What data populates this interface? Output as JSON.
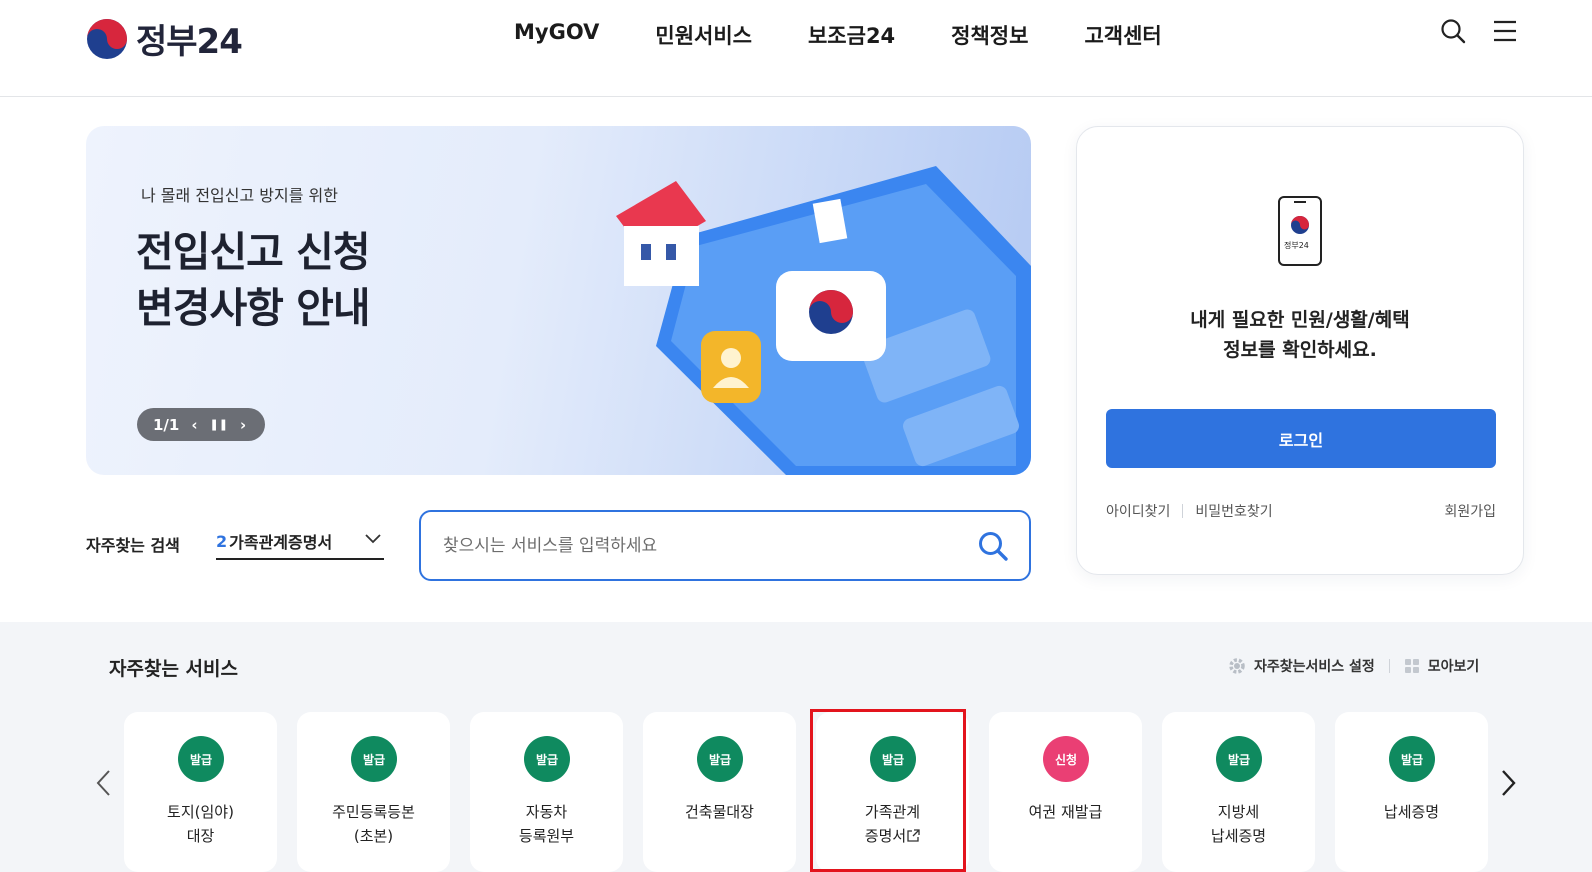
{
  "header": {
    "logo_text": "정부24",
    "nav": [
      "MyGOV",
      "민원서비스",
      "보조금24",
      "정책정보",
      "고객센터"
    ],
    "icons": [
      "search-icon",
      "menu-icon"
    ]
  },
  "banner": {
    "subtitle": "나 몰래 전입신고 방지를 위한",
    "title_line1": "전입신고 신청",
    "title_line2": "변경사항 안내",
    "pager": "1/1",
    "controls": [
      "chevron-left-icon",
      "pause-icon",
      "chevron-right-icon"
    ]
  },
  "login": {
    "app_label": "정부24",
    "message_line1": "내게 필요한 민원/생활/혜택",
    "message_line2": "정보를 확인하세요.",
    "button": "로그인",
    "find_id": "아이디찾기",
    "find_pw": "비밀번호찾기",
    "join": "회원가입"
  },
  "frequent_search": {
    "label": "자주찾는 검색",
    "rank": "2",
    "term": "가족관계증명서"
  },
  "search": {
    "placeholder": "찾으시는 서비스를 입력하세요"
  },
  "services": {
    "title": "자주찾는 서비스",
    "settings_label": "자주찾는서비스 설정",
    "view_all_label": "모아보기",
    "cards": [
      {
        "badge": "발급",
        "line1": "토지(임야)",
        "line2": "대장"
      },
      {
        "badge": "발급",
        "line1": "주민등록등본",
        "line2": "(초본)"
      },
      {
        "badge": "발급",
        "line1": "자동차",
        "line2": "등록원부"
      },
      {
        "badge": "발급",
        "line1": "건축물대장",
        "line2": ""
      },
      {
        "badge": "발급",
        "line1": "가족관계",
        "line2": "증명서"
      },
      {
        "badge": "신청",
        "line1": "여권 재발급",
        "line2": ""
      },
      {
        "badge": "발급",
        "line1": "지방세",
        "line2": "납세증명"
      },
      {
        "badge": "발급",
        "line1": "납세증명",
        "line2": ""
      }
    ]
  },
  "colors": {
    "primary": "#2f73df",
    "issue_badge": "#0f8a5f",
    "apply_badge": "#ea3f74",
    "highlight": "#e3141d"
  }
}
